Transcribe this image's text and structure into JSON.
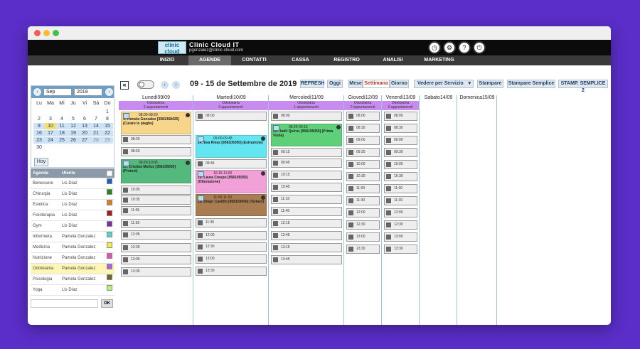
{
  "header": {
    "brand": "Clinic Cloud IT",
    "email": "pgonzalez@clinic-cloud.com",
    "logo_text": "clinic cloud"
  },
  "nav": [
    "INIZIO",
    "AGENDE",
    "CONTATTI",
    "CASSA",
    "REGISTRO",
    "ANALISI",
    "MARKETING"
  ],
  "toolbar": {
    "date_range": "09 - 15 de Settembre de 2019",
    "refresh": "REFRESH",
    "oggi": "Oggi",
    "mese": "Mese",
    "settimana": "Settimana",
    "giorno": "Giorno",
    "vedere": "Vedere per Servizio",
    "stampare": "Stampare",
    "stampare_semplice": "Stampare Semplice",
    "stamp_semplice2": "STAMP. SEMPLICE 2"
  },
  "calendar": {
    "month": "Sep",
    "year": "2019",
    "weekdays": [
      "Lu",
      "Ma",
      "Mi",
      "Ju",
      "Vi",
      "Sá",
      "Do"
    ],
    "weeks": [
      [
        "",
        "",
        "",
        "",
        "",
        "",
        "1"
      ],
      [
        "2",
        "3",
        "4",
        "5",
        "6",
        "7",
        "8"
      ],
      [
        "9",
        "10",
        "11",
        "12",
        "13",
        "14",
        "15"
      ],
      [
        "16",
        "17",
        "18",
        "19",
        "20",
        "21",
        "22"
      ],
      [
        "23",
        "24",
        "25",
        "26",
        "27",
        "28",
        "29"
      ],
      [
        "30",
        "",
        "",
        "",
        "",
        "",
        ""
      ]
    ],
    "hoy": "Hoy"
  },
  "agenda_table": {
    "headers": [
      "Agenda",
      "Utente"
    ],
    "rows": [
      {
        "agenda": "Benessere",
        "utente": "Lis Díaz",
        "color": "#1f5fc9"
      },
      {
        "agenda": "Chirurgia",
        "utente": "Lis Díaz",
        "color": "#1e8a1e"
      },
      {
        "agenda": "Estetica",
        "utente": "Lis Díaz",
        "color": "#e07a1a"
      },
      {
        "agenda": "Fisioterapia",
        "utente": "Lis Díaz",
        "color": "#b01818"
      },
      {
        "agenda": "Gym",
        "utente": "Lis Díaz",
        "color": "#7a2ea3"
      },
      {
        "agenda": "Infermiera",
        "utente": "Pamela Gonzalez",
        "color": "#52d6c8"
      },
      {
        "agenda": "Medicina",
        "utente": "Pamela Gonzalez",
        "color": "#f2ef3c"
      },
      {
        "agenda": "Nutrizione",
        "utente": "Pamela Gonzalez",
        "color": "#e94fb3"
      },
      {
        "agenda": "Odotoiatria",
        "utente": "Pamela Gonzalez",
        "color": "#b05fe6"
      },
      {
        "agenda": "Psicologia",
        "utente": "Pamela Gonzalez",
        "color": "#6b6b20"
      },
      {
        "agenda": "Yoga",
        "utente": "Lis Díaz",
        "color": "#b9ef7a"
      }
    ],
    "ok": "OK"
  },
  "days": [
    {
      "label": "Lunedì09/09",
      "info": "Odotoiatria",
      "count": "2 appuntamenti"
    },
    {
      "label": "Martedì10/09",
      "info": "Odotoiatria",
      "count": "3 appuntamenti"
    },
    {
      "label": "Mercoledì11/09",
      "info": "Odotoiatria",
      "count": "1 appuntamenti"
    },
    {
      "label": "Giovedì12/09",
      "info": "Odotoiatria",
      "count": "0 appuntamenti"
    },
    {
      "label": "Venerdì13/09",
      "info": "Odotoiatria",
      "count": "0 appuntamenti"
    },
    {
      "label": "Sabato14/09",
      "info": "",
      "count": ""
    },
    {
      "label": "Domenica15/09",
      "info": "",
      "count": ""
    }
  ],
  "slots": {
    "mon": [
      "08:20",
      "08:50",
      "10:05",
      "10:35",
      "11:05",
      "11:35",
      "12:05",
      "12:35",
      "13:05",
      "13:35"
    ],
    "tue": [
      "08:00",
      "09:45",
      "11:30",
      "12:00",
      "12:30",
      "13:00",
      "13:30"
    ],
    "wed": [
      "08:00",
      "09:15",
      "09:45",
      "10:15",
      "10:45",
      "11:15",
      "11:45",
      "12:15",
      "12:45",
      "13:15",
      "13:45"
    ],
    "thu": [
      "08:00",
      "08:30",
      "09:00",
      "09:30",
      "10:00",
      "10:30",
      "11:00",
      "11:30",
      "12:00",
      "12:30",
      "13:00",
      "13:30"
    ],
    "fri": [
      "08:00",
      "08:30",
      "09:00",
      "09:30",
      "10:00",
      "10:30",
      "11:00",
      "11:30",
      "12:00",
      "12:30",
      "13:00",
      "13:30"
    ]
  },
  "appointments": [
    {
      "time": "08:00-08:20",
      "title": "3. Pamela Gonzalez [3581368425] (Curare le piaghe)",
      "color": "#f7d58a"
    },
    {
      "time": "09:20-10:05",
      "title": "27. Cristina Muñoz [358105050] (Protesi)",
      "color": "#54b97c"
    },
    {
      "time": "09:00-09:45",
      "title": "24. Eva Rivas [958105050] (Estrazione)",
      "color": "#63e6f2"
    },
    {
      "time": "10:15-11:00",
      "title": "26. Laura Crespo [958105050] (Otturazione)",
      "color": "#f1a0d8"
    },
    {
      "time": "11:00-11:30",
      "title": "28. Diego Castillo [958105050] (Tartaro)",
      "color": "#a97c52"
    },
    {
      "time": "08:20-09:15",
      "title": "25. Judit Quiroz [958105050] (Prima Visita)",
      "color": "#5fd07a"
    }
  ]
}
